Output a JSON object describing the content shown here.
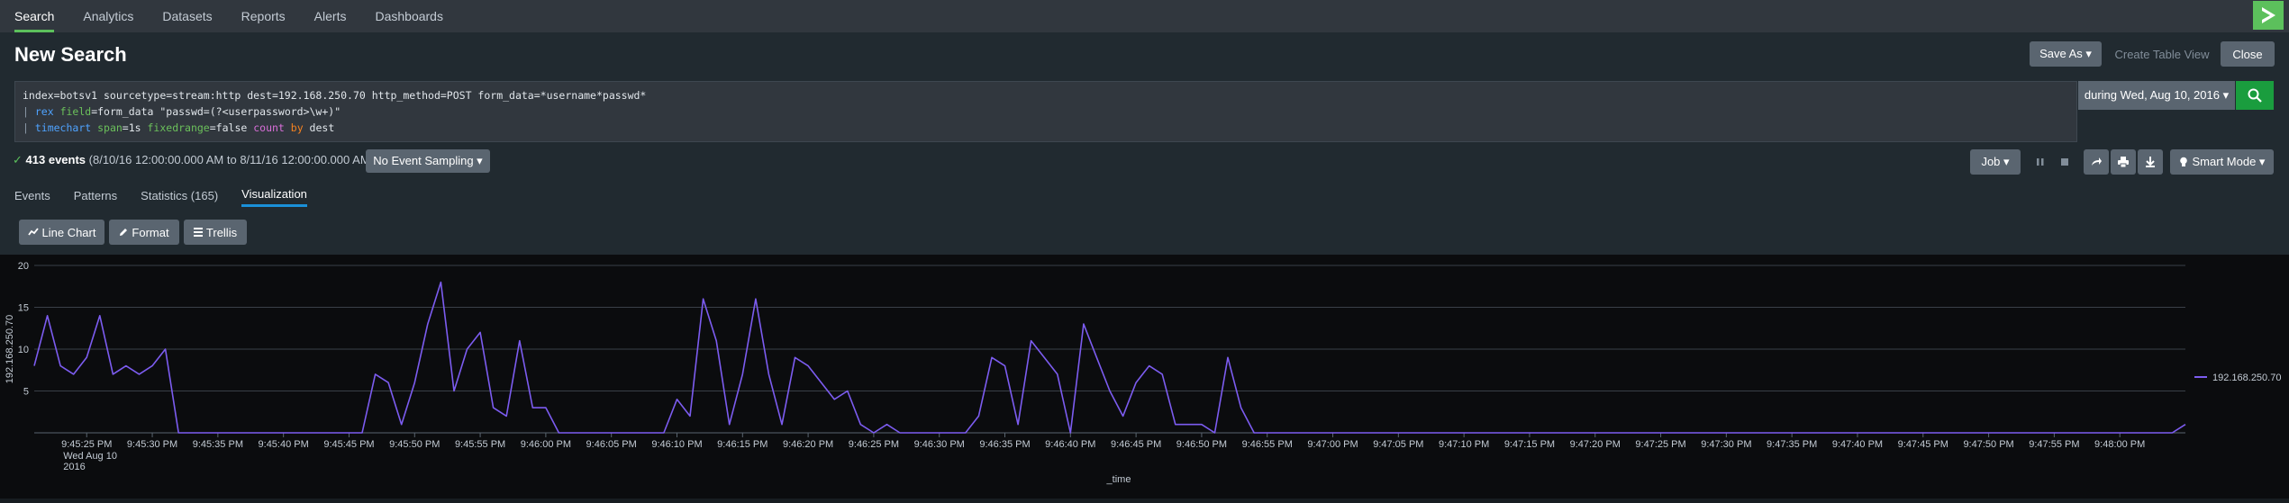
{
  "nav": {
    "tabs": [
      "Search",
      "Analytics",
      "Datasets",
      "Reports",
      "Alerts",
      "Dashboards"
    ],
    "active": "Search"
  },
  "page": {
    "title": "New Search",
    "save_as": "Save As ▾",
    "create_table_view": "Create Table View",
    "close": "Close"
  },
  "query": {
    "line1": "index=botsv1 sourcetype=stream:http dest=192.168.250.70 http_method=POST form_data=*username*passwd*",
    "line2_pipe": "| ",
    "line2_cmd": "rex",
    "line2_arg": " field",
    "line2_rest": "=form_data \"passwd=(?<userpassword>\\w+)\"",
    "line3_pipe": "| ",
    "line3_cmd": "timechart",
    "line3_arg1": " span",
    "line3_val1": "=1s ",
    "line3_arg2": "fixedrange",
    "line3_val2": "=false ",
    "line3_fn": "count",
    "line3_kw": " by",
    "line3_rest": " dest"
  },
  "time_picker": {
    "label": "during Wed, Aug 10, 2016 ▾"
  },
  "status": {
    "check": "✓",
    "events": "413 events",
    "range": " (8/10/16 12:00:00.000 AM to 8/11/16 12:00:00.000 AM)",
    "sampling": "No Event Sampling ▾",
    "job": "Job ▾",
    "mode": "Smart Mode ▾"
  },
  "result_tabs": {
    "items": [
      "Events",
      "Patterns",
      "Statistics (165)",
      "Visualization"
    ],
    "active": "Visualization"
  },
  "viz_toolbar": {
    "line_chart": "Line Chart",
    "format": "Format",
    "trellis": "Trellis"
  },
  "colors": {
    "series": "#7c5cf0",
    "accent_green": "#5cc05c",
    "tab_underline": "#1a90d8"
  },
  "chart_data": {
    "type": "line",
    "xlabel": "_time",
    "ylabel": "192.168.250.70",
    "ylim": [
      0,
      20
    ],
    "yticks": [
      5,
      10,
      15,
      20
    ],
    "x_start": "9:45:25 PM",
    "x_first_label_extra": [
      "Wed Aug 10",
      "2016"
    ],
    "x_tick_labels": [
      "9:45:25 PM",
      "9:45:30 PM",
      "9:45:35 PM",
      "9:45:40 PM",
      "9:45:45 PM",
      "9:45:50 PM",
      "9:45:55 PM",
      "9:46:00 PM",
      "9:46:05 PM",
      "9:46:10 PM",
      "9:46:15 PM",
      "9:46:20 PM",
      "9:46:25 PM",
      "9:46:30 PM",
      "9:46:35 PM",
      "9:46:40 PM",
      "9:46:45 PM",
      "9:46:50 PM",
      "9:46:55 PM",
      "9:47:00 PM",
      "9:47:05 PM",
      "9:47:10 PM",
      "9:47:15 PM",
      "9:47:20 PM",
      "9:47:25 PM",
      "9:47:30 PM",
      "9:47:35 PM",
      "9:47:40 PM",
      "9:47:45 PM",
      "9:47:50 PM",
      "9:47:55 PM",
      "9:48:00 PM"
    ],
    "x_first_second": "9:45:21 PM",
    "series": [
      {
        "name": "192.168.250.70",
        "values": [
          8,
          14,
          8,
          7,
          9,
          14,
          7,
          8,
          7,
          8,
          10,
          0,
          0,
          0,
          0,
          0,
          0,
          0,
          0,
          0,
          0,
          0,
          0,
          0,
          0,
          0,
          7,
          6,
          1,
          6,
          13,
          18,
          5,
          10,
          12,
          3,
          2,
          11,
          3,
          3,
          0,
          0,
          0,
          0,
          0,
          0,
          0,
          0,
          0,
          4,
          2,
          16,
          11,
          1,
          7,
          16,
          7,
          1,
          9,
          8,
          6,
          4,
          5,
          1,
          0,
          1,
          0,
          0,
          0,
          0,
          0,
          0,
          2,
          9,
          8,
          1,
          11,
          9,
          7,
          0,
          13,
          9,
          5,
          2,
          6,
          8,
          7,
          1,
          1,
          1,
          0,
          9,
          3,
          0,
          0,
          0,
          0,
          0,
          0,
          0,
          0,
          0,
          0,
          0,
          0,
          0,
          0,
          0,
          0,
          0,
          0,
          0,
          0,
          0,
          0,
          0,
          0,
          0,
          0,
          0,
          0,
          0,
          0,
          0,
          0,
          0,
          0,
          0,
          0,
          0,
          0,
          0,
          0,
          0,
          0,
          0,
          0,
          0,
          0,
          0,
          0,
          0,
          0,
          0,
          0,
          0,
          0,
          0,
          0,
          0,
          0,
          0,
          0,
          0,
          0,
          0,
          0,
          0,
          0,
          0,
          0,
          0,
          0,
          0,
          1
        ]
      }
    ],
    "legend": "right"
  }
}
